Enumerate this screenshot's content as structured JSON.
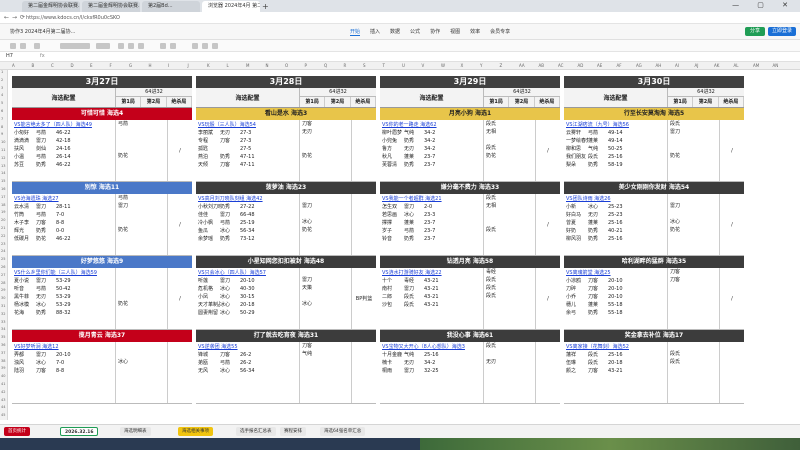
{
  "browser": {
    "tabs": [
      "第二届金辉明协会联赛...",
      "第二届金辉明协会联赛...",
      "第2届Bd...",
      "浏览器 2024年4月 第二届..."
    ],
    "url": "https://www.kdocs.cn/l/cksfR0u0cSKO",
    "window_controls": "— ▢ ✕"
  },
  "doc": {
    "title": "协作3  2024年4月第二届协...",
    "menu": [
      "开始",
      "插入",
      "数据",
      "公式",
      "协作",
      "视图",
      "效率",
      "会员专享"
    ],
    "active_menu": "开始",
    "share": "分享",
    "login": "立即登录"
  },
  "formula": {
    "cell": "H7",
    "fx": "fx"
  },
  "days": [
    {
      "title": "3月27日",
      "hx": "海选配置",
      "score": "64进32",
      "cols": [
        "第1局",
        "第2局",
        "绝杀局"
      ],
      "blocks": [
        {
          "head": "可惜可惜 海选4",
          "color": "red",
          "vs": "VS能言绝太多了（四人队）海选49",
          "players": [
            [
              "小匆好",
              "弓箭",
              "46-22"
            ],
            [
              "滴滴滴",
              "雷刀",
              "42-18"
            ],
            [
              "扶风",
              "剑仙",
              "24-16"
            ],
            [
              "小温",
              "弓箭",
              "26-14"
            ],
            [
              "苏豆",
              "奶秀",
              "46-22"
            ]
          ],
          "side": [
            "弓箭",
            "",
            "",
            "",
            "奶花"
          ],
          "ex": "/"
        },
        {
          "head": "别惊 海选11",
          "color": "blue",
          "vs": "VS沧海遗珠 海选27",
          "players": [
            [
              "云水清",
              "雷刀",
              "28-11"
            ],
            [
              "竹筒",
              "弓箭",
              "7-0"
            ],
            [
              "木子李",
              "刀客",
              "8-8"
            ],
            [
              "辉光",
              "奶秀",
              "0-0"
            ],
            [
              "低碳月",
              "奶花",
              "46-22"
            ]
          ],
          "side": [
            "弓箭",
            "雷刀",
            "",
            "",
            "奶花"
          ],
          "ex": "/"
        },
        {
          "head": "好梦悠悠 海选9",
          "color": "blue",
          "vs": "VS什么乡里你们能（三人队）海选59",
          "players": [
            [
              "夏小说",
              "雷刀",
              "53-29"
            ],
            [
              "听音",
              "弓箭",
              "50-42"
            ],
            [
              "黑牛菲",
              "无刃",
              "53-29"
            ],
            [
              "杨冰模",
              "冰心",
              "53-29"
            ],
            [
              "花海",
              "奶秀",
              "88-32"
            ]
          ],
          "side": [
            "",
            "",
            "",
            "",
            "奶花"
          ],
          "ex": "/"
        },
        {
          "head": "揽月青云 海选37",
          "color": "red",
          "vs": "VS好梦听涧 海选12",
          "players": [
            [
              "弄都",
              "雷刀",
              "20-10"
            ],
            [
              "浊风",
              "冰心",
              "7-0"
            ],
            [
              "陆羽",
              "刀客",
              "8-8"
            ]
          ],
          "side": [
            "",
            "",
            "冰心"
          ],
          "ex": ""
        }
      ]
    },
    {
      "title": "3月28日",
      "hx": "海选配置",
      "score": "64进32",
      "cols": [
        "第1局",
        "第2局",
        "绝杀局"
      ],
      "blocks": [
        {
          "head": "看山是水 海选3",
          "color": "yellow",
          "vs": "VS玩骰（三人队）海选54",
          "players": [
            [
              "李丽斌",
              "无刃",
              "27-3"
            ],
            [
              "专程",
              "刀客",
              "27-3"
            ],
            [
              "孤匙",
              "",
              "27-5"
            ],
            [
              "燕泊",
              "奶秀",
              "47-11"
            ],
            [
              "天倾",
              "刀客",
              "47-11"
            ]
          ],
          "side": [
            "刀客",
            "无刃",
            "",
            "",
            "奶花"
          ],
          "ex": ""
        },
        {
          "head": "菠萝油 海选23",
          "color": "dark",
          "vs": "VS高月刘刀晓队刻组 海选42",
          "players": [
            [
              "小秋刘刀晓",
              "奶秀",
              "27-22"
            ],
            [
              "佳佳",
              "雷刀",
              "66-48"
            ],
            [
              "冷小枫",
              "弓箭",
              "25-19"
            ],
            [
              "鱼瓜",
              "冰心",
              "56-34"
            ],
            [
              "余梦瑶",
              "奶秀",
              "73-12"
            ]
          ],
          "side": [
            "",
            "雷刀",
            "",
            "冰心",
            "奶花"
          ],
          "ex": ""
        },
        {
          "head": "小星知网您扣扣被封 海选48",
          "color": "dark",
          "vs": "VS只会冰心（四人队）海选57",
          "players": [
            [
              "听莲",
              "雷刀",
              "20-10"
            ],
            [
              "危机格",
              "冰心",
              "40-30"
            ],
            [
              "小凤",
              "冰心",
              "30-15"
            ],
            [
              "天才革制品",
              "冰心",
              "20-18"
            ],
            [
              "圆妻荆留",
              "冰心",
              "50-29"
            ]
          ],
          "side": [
            "",
            "雷刀",
            "天策",
            "",
            "冰心"
          ],
          "ex": "BP判篮"
        },
        {
          "head": "打了就去吃宵夜 海选31",
          "color": "dark",
          "vs": "VS逆袭团 海选55",
          "players": [
            [
              "锋城",
              "刀客",
              "26-2"
            ],
            [
              "弟瓯",
              "弓箭",
              "26-2"
            ],
            [
              "无风",
              "冰心",
              "56-34"
            ]
          ],
          "side": [
            "刀客",
            "气纯",
            ""
          ],
          "ex": ""
        }
      ]
    },
    {
      "title": "3月29日",
      "hx": "海选配置",
      "score": "64进32",
      "cols": [
        "第1局",
        "第2局",
        "绝杀局"
      ],
      "blocks": [
        {
          "head": "月亮小狗 海选1",
          "color": "yellow",
          "vs": "VS你的老一路走 海选62",
          "players": [
            [
              "柳叶眉梦",
              "气纯",
              "34-2"
            ],
            [
              "小兜兔",
              "奶秀",
              "34-2"
            ],
            [
              "鲁方",
              "无刃",
              "34-2"
            ],
            [
              "秋凡",
              "蓬莱",
              "23-7"
            ],
            [
              "芙蓉清",
              "奶秀",
              "23-7"
            ]
          ],
          "side": [
            "段氏",
            "无相",
            "",
            "段氏",
            "奶花"
          ],
          "ex": "/"
        },
        {
          "head": "嫌分毫不费力 海选33",
          "color": "dark",
          "vs": "VS我能一个者超群 海选21",
          "players": [
            [
              "怎生双",
              "雷刀",
              "2-0"
            ],
            [
              "若思画",
              "冰心",
              "23-3"
            ],
            [
              "撑撑",
              "蓬莱",
              "23-7"
            ],
            [
              "岁子",
              "弓箭",
              "23-7"
            ],
            [
              "铃音",
              "奶秀",
              "23-7"
            ]
          ],
          "side": [
            "段氏",
            "无相",
            "",
            "",
            "段氏"
          ],
          "ex": "/"
        },
        {
          "head": "钻透月亮 海选58",
          "color": "dark",
          "vs": "VS涟水打游骑好友 海选22",
          "players": [
            [
              "十个",
              "毒经",
              "43-21"
            ],
            [
              "南村",
              "雷刀",
              "43-21"
            ],
            [
              "二郎",
              "段氏",
              "43-21"
            ],
            [
              "沙包",
              "段氏",
              "43-21"
            ]
          ],
          "side": [
            "毒经",
            "段氏",
            "段氏",
            "段氏"
          ],
          "ex": "/"
        },
        {
          "head": "我没心事 海选61",
          "color": "dark",
          "vs": "VS宝物又大开心（8人心想队）海选3",
          "players": [
            [
              "十月金鹿",
              "气纯",
              "25-16"
            ],
            [
              "楠卡",
              "无刃",
              "34-2"
            ],
            [
              "桐雨",
              "雷刀",
              "32-25"
            ]
          ],
          "side": [
            "段氏",
            "",
            "无刃"
          ],
          "ex": ""
        }
      ]
    },
    {
      "title": "3月30日",
      "hx": "海选配置",
      "score": "64进32",
      "cols": [
        "第1局",
        "第2局",
        "绝杀局"
      ],
      "blocks": [
        {
          "head": "行至长安莫淘淘 海选5",
          "color": "yellow",
          "vs": "VS江湖痞流（九号）海选56",
          "players": [
            [
              "云雾轩",
              "弓箭",
              "49-14"
            ],
            [
              "一梦绘春蕉",
              "蓬莱",
              "49-14"
            ],
            [
              "柳和思",
              "气纯",
              "50-25"
            ],
            [
              "我们朋友",
              "段氏",
              "25-16"
            ],
            [
              "梨朵",
              "奶秀",
              "58-19"
            ]
          ],
          "side": [
            "段氏",
            "雷刀",
            "",
            "",
            "奶花"
          ],
          "ex": "/"
        },
        {
          "head": "美少女刚刚你发财 海选54",
          "color": "dark",
          "vs": "VS团队诗雨 海选26",
          "players": [
            [
              "小新",
              "冰心",
              "25-23"
            ],
            [
              "好白马",
              "无刃",
              "25-23"
            ],
            [
              "曾夏",
              "蓬莱",
              "25-16"
            ],
            [
              "好奶",
              "奶秀",
              "40-21"
            ],
            [
              "柳风羽",
              "奶秀",
              "25-16"
            ]
          ],
          "side": [
            "",
            "雷刀",
            "",
            "冰心",
            "奶花"
          ],
          "ex": "/"
        },
        {
          "head": "哈利湖畔的猛群 海选35",
          "color": "dark",
          "vs": "VS离魂箭堂 海选25",
          "players": [
            [
              "小凉鸥",
              "刀客",
              "20-10"
            ],
            [
              "刀碎",
              "刀客",
              "20-10"
            ],
            [
              "小乔",
              "刀客",
              "20-10"
            ],
            [
              "穗儿",
              "蓬莱",
              "55-18"
            ],
            [
              "余弓",
              "奶秀",
              "55-18"
            ]
          ],
          "side": [
            "刀客",
            "刀客",
            "",
            "",
            ""
          ],
          "ex": "/"
        },
        {
          "head": "奖金拿去补位 海选17",
          "color": "dark",
          "vs": "VS离家接（花舞剑）海选52",
          "players": [
            [
              "藩祥",
              "段氏",
              "25-16"
            ],
            [
              "伍琳",
              "段氏",
              "20-18"
            ],
            [
              "颜之",
              "刀客",
              "43-21"
            ]
          ],
          "side": [
            "",
            "段氏",
            "段氏"
          ],
          "ex": ""
        }
      ]
    }
  ],
  "sheet_tabs": [
    "首页统计",
    "2026.32.16",
    "海选明细表",
    "海选相关事项",
    "选手报名汇总表",
    "赛程安排",
    "海选64强名单汇总"
  ],
  "active_sheet": "2026.32.16"
}
